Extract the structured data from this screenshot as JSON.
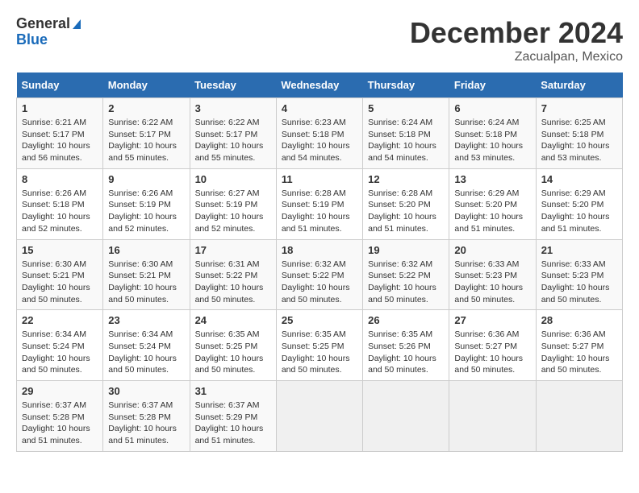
{
  "logo": {
    "line1": "General",
    "line2": "Blue"
  },
  "title": "December 2024",
  "subtitle": "Zacualpan, Mexico",
  "weekdays": [
    "Sunday",
    "Monday",
    "Tuesday",
    "Wednesday",
    "Thursday",
    "Friday",
    "Saturday"
  ],
  "weeks": [
    [
      {
        "day": "1",
        "sunrise": "6:21 AM",
        "sunset": "5:17 PM",
        "daylight": "10 hours and 56 minutes."
      },
      {
        "day": "2",
        "sunrise": "6:22 AM",
        "sunset": "5:17 PM",
        "daylight": "10 hours and 55 minutes."
      },
      {
        "day": "3",
        "sunrise": "6:22 AM",
        "sunset": "5:17 PM",
        "daylight": "10 hours and 55 minutes."
      },
      {
        "day": "4",
        "sunrise": "6:23 AM",
        "sunset": "5:18 PM",
        "daylight": "10 hours and 54 minutes."
      },
      {
        "day": "5",
        "sunrise": "6:24 AM",
        "sunset": "5:18 PM",
        "daylight": "10 hours and 54 minutes."
      },
      {
        "day": "6",
        "sunrise": "6:24 AM",
        "sunset": "5:18 PM",
        "daylight": "10 hours and 53 minutes."
      },
      {
        "day": "7",
        "sunrise": "6:25 AM",
        "sunset": "5:18 PM",
        "daylight": "10 hours and 53 minutes."
      }
    ],
    [
      {
        "day": "8",
        "sunrise": "6:26 AM",
        "sunset": "5:18 PM",
        "daylight": "10 hours and 52 minutes."
      },
      {
        "day": "9",
        "sunrise": "6:26 AM",
        "sunset": "5:19 PM",
        "daylight": "10 hours and 52 minutes."
      },
      {
        "day": "10",
        "sunrise": "6:27 AM",
        "sunset": "5:19 PM",
        "daylight": "10 hours and 52 minutes."
      },
      {
        "day": "11",
        "sunrise": "6:28 AM",
        "sunset": "5:19 PM",
        "daylight": "10 hours and 51 minutes."
      },
      {
        "day": "12",
        "sunrise": "6:28 AM",
        "sunset": "5:20 PM",
        "daylight": "10 hours and 51 minutes."
      },
      {
        "day": "13",
        "sunrise": "6:29 AM",
        "sunset": "5:20 PM",
        "daylight": "10 hours and 51 minutes."
      },
      {
        "day": "14",
        "sunrise": "6:29 AM",
        "sunset": "5:20 PM",
        "daylight": "10 hours and 51 minutes."
      }
    ],
    [
      {
        "day": "15",
        "sunrise": "6:30 AM",
        "sunset": "5:21 PM",
        "daylight": "10 hours and 50 minutes."
      },
      {
        "day": "16",
        "sunrise": "6:30 AM",
        "sunset": "5:21 PM",
        "daylight": "10 hours and 50 minutes."
      },
      {
        "day": "17",
        "sunrise": "6:31 AM",
        "sunset": "5:22 PM",
        "daylight": "10 hours and 50 minutes."
      },
      {
        "day": "18",
        "sunrise": "6:32 AM",
        "sunset": "5:22 PM",
        "daylight": "10 hours and 50 minutes."
      },
      {
        "day": "19",
        "sunrise": "6:32 AM",
        "sunset": "5:22 PM",
        "daylight": "10 hours and 50 minutes."
      },
      {
        "day": "20",
        "sunrise": "6:33 AM",
        "sunset": "5:23 PM",
        "daylight": "10 hours and 50 minutes."
      },
      {
        "day": "21",
        "sunrise": "6:33 AM",
        "sunset": "5:23 PM",
        "daylight": "10 hours and 50 minutes."
      }
    ],
    [
      {
        "day": "22",
        "sunrise": "6:34 AM",
        "sunset": "5:24 PM",
        "daylight": "10 hours and 50 minutes."
      },
      {
        "day": "23",
        "sunrise": "6:34 AM",
        "sunset": "5:24 PM",
        "daylight": "10 hours and 50 minutes."
      },
      {
        "day": "24",
        "sunrise": "6:35 AM",
        "sunset": "5:25 PM",
        "daylight": "10 hours and 50 minutes."
      },
      {
        "day": "25",
        "sunrise": "6:35 AM",
        "sunset": "5:25 PM",
        "daylight": "10 hours and 50 minutes."
      },
      {
        "day": "26",
        "sunrise": "6:35 AM",
        "sunset": "5:26 PM",
        "daylight": "10 hours and 50 minutes."
      },
      {
        "day": "27",
        "sunrise": "6:36 AM",
        "sunset": "5:27 PM",
        "daylight": "10 hours and 50 minutes."
      },
      {
        "day": "28",
        "sunrise": "6:36 AM",
        "sunset": "5:27 PM",
        "daylight": "10 hours and 50 minutes."
      }
    ],
    [
      {
        "day": "29",
        "sunrise": "6:37 AM",
        "sunset": "5:28 PM",
        "daylight": "10 hours and 51 minutes."
      },
      {
        "day": "30",
        "sunrise": "6:37 AM",
        "sunset": "5:28 PM",
        "daylight": "10 hours and 51 minutes."
      },
      {
        "day": "31",
        "sunrise": "6:37 AM",
        "sunset": "5:29 PM",
        "daylight": "10 hours and 51 minutes."
      },
      null,
      null,
      null,
      null
    ]
  ]
}
